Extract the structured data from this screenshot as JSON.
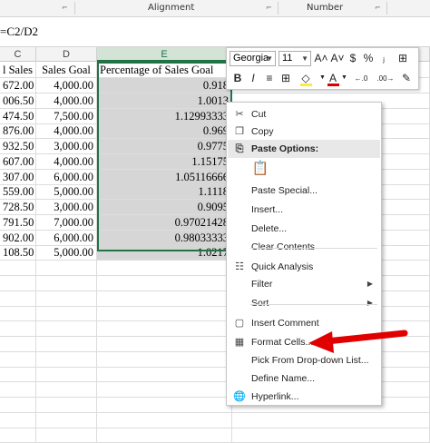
{
  "ribbon": {
    "alignment_label": "Alignment",
    "number_label": "Number",
    "launcher_glyph": "⌐"
  },
  "formula_bar": {
    "text": "=C2/D2"
  },
  "columns": [
    {
      "name": "C",
      "selected": false
    },
    {
      "name": "D",
      "selected": false
    },
    {
      "name": "E",
      "selected": true
    }
  ],
  "sheet": {
    "headers": [
      "l Sales",
      "Sales Goal",
      "Percentage of Sales Goal"
    ],
    "rows": [
      {
        "c": "672.00",
        "d": "4,000.00",
        "e": "0.918"
      },
      {
        "c": "006.50",
        "d": "4,000.00",
        "e": "1.0013"
      },
      {
        "c": "474.50",
        "d": "7,500.00",
        "e": "1.12993333"
      },
      {
        "c": "876.00",
        "d": "4,000.00",
        "e": "0.969"
      },
      {
        "c": "932.50",
        "d": "3,000.00",
        "e": "0.9775"
      },
      {
        "c": "607.00",
        "d": "4,000.00",
        "e": "1.15175"
      },
      {
        "c": "307.00",
        "d": "6,000.00",
        "e": "1.05116666"
      },
      {
        "c": "559.00",
        "d": "5,000.00",
        "e": "1.1118"
      },
      {
        "c": "728.50",
        "d": "3,000.00",
        "e": "0.9095"
      },
      {
        "c": "791.50",
        "d": "7,000.00",
        "e": "0.97021428"
      },
      {
        "c": "902.00",
        "d": "6,000.00",
        "e": "0.98033333"
      },
      {
        "c": "108.50",
        "d": "5,000.00",
        "e": "1.0217"
      }
    ]
  },
  "mini_toolbar": {
    "font_name": "Georgia",
    "font_size": "11",
    "grow_font": "A˄",
    "shrink_font": "A˅",
    "currency": "$",
    "percent": "%",
    "comma": "ⱼ",
    "merge": "⊞",
    "bold": "B",
    "italic": "I",
    "align_center": "≡",
    "borders": "⊞",
    "fill": "◇",
    "font_color": "A",
    "inc_decimal": "←.0",
    "dec_decimal": ".00→",
    "format_painter": "✎",
    "fill_color": "#ffeb3b",
    "font_color_hex": "#e00000"
  },
  "context_menu": {
    "items": [
      {
        "label": "Cut",
        "icon": "scissors-icon",
        "glyph": "✂"
      },
      {
        "label": "Copy",
        "icon": "copy-icon",
        "glyph": "❐"
      },
      {
        "label": "Paste Options:",
        "icon": "paste-icon",
        "glyph": "⎘",
        "header": true
      },
      {
        "label": "",
        "icon": "paste-clipboard-icon",
        "glyph": "📋"
      },
      {
        "label": "Paste Special...",
        "icon": "",
        "glyph": ""
      },
      {
        "label": "Insert...",
        "icon": "",
        "glyph": ""
      },
      {
        "label": "Delete...",
        "icon": "",
        "glyph": ""
      },
      {
        "label": "Clear Contents",
        "icon": "",
        "glyph": ""
      },
      {
        "label": "Quick Analysis",
        "icon": "quick-analysis-icon",
        "glyph": "☷"
      },
      {
        "label": "Filter",
        "icon": "",
        "glyph": "",
        "submenu": true
      },
      {
        "label": "Sort",
        "icon": "",
        "glyph": "",
        "submenu": true
      },
      {
        "label": "Insert Comment",
        "icon": "comment-icon",
        "glyph": "▢"
      },
      {
        "label": "Format Cells...",
        "icon": "format-cells-icon",
        "glyph": "▦"
      },
      {
        "label": "Pick From Drop-down List...",
        "icon": "",
        "glyph": ""
      },
      {
        "label": "Define Name...",
        "icon": "",
        "glyph": ""
      },
      {
        "label": "Hyperlink...",
        "icon": "hyperlink-icon",
        "glyph": "🌐"
      }
    ],
    "submenu_glyph": "▶"
  },
  "annotation": {
    "arrow_color": "#e00000"
  }
}
